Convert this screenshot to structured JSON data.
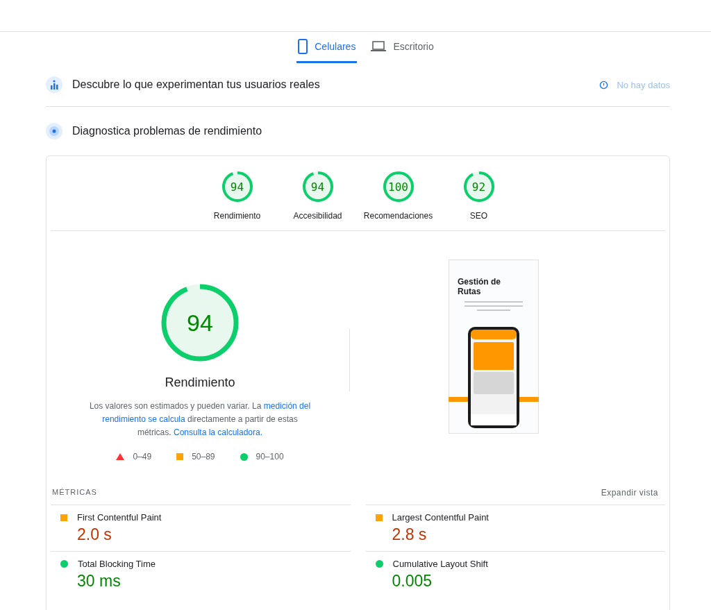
{
  "tabs": [
    {
      "label": "Celulares",
      "selected": true
    },
    {
      "label": "Escritorio",
      "selected": false
    }
  ],
  "field_data": {
    "title": "Descubre lo que experimentan tus usuarios reales",
    "status": "No hay datos"
  },
  "diagnostics": {
    "title": "Diagnostica problemas de rendimiento"
  },
  "categories": [
    {
      "score": "94",
      "label": "Rendimiento"
    },
    {
      "score": "94",
      "label": "Accesibilidad"
    },
    {
      "score": "100",
      "label": "Recomendaciones"
    },
    {
      "score": "92",
      "label": "SEO"
    }
  ],
  "main_gauge": {
    "score": "94",
    "label": "Rendimiento"
  },
  "description": [
    {
      "text": "Los valores son estimados y pueden variar. La ",
      "link": false
    },
    {
      "text": "medición del",
      "link": true
    },
    {
      "text": " rendimiento se calcula",
      "link": true
    },
    {
      "text": " directamente a partir de estas métricas. ",
      "link": false
    },
    {
      "text": "Consulta la calculadora.",
      "link": true
    }
  ],
  "legend": [
    {
      "kind": "triangle",
      "range": "0–49",
      "color": "#ff3333"
    },
    {
      "kind": "square",
      "range": "50–89",
      "color": "#ffa400"
    },
    {
      "kind": "circle",
      "range": "90–100",
      "color": "#0cce6b"
    }
  ],
  "screenshot": {
    "title": "Gestión de Rutas"
  },
  "metrics_header": "MÉTRICAS",
  "expand_link": "Expandir vista",
  "metrics": [
    {
      "name": "First Contentful Paint",
      "value": "2.0 s",
      "kind": "square",
      "color": "#ffa400"
    },
    {
      "name": "Largest Contentful Paint",
      "value": "2.8 s",
      "kind": "square",
      "color": "#ffa400"
    },
    {
      "name": "Total Blocking Time",
      "value": "30 ms",
      "kind": "circle",
      "color": "#0cce6b"
    },
    {
      "name": "Cumulative Layout Shift",
      "value": "0.005",
      "kind": "circle",
      "color": "#0cce6b"
    }
  ]
}
